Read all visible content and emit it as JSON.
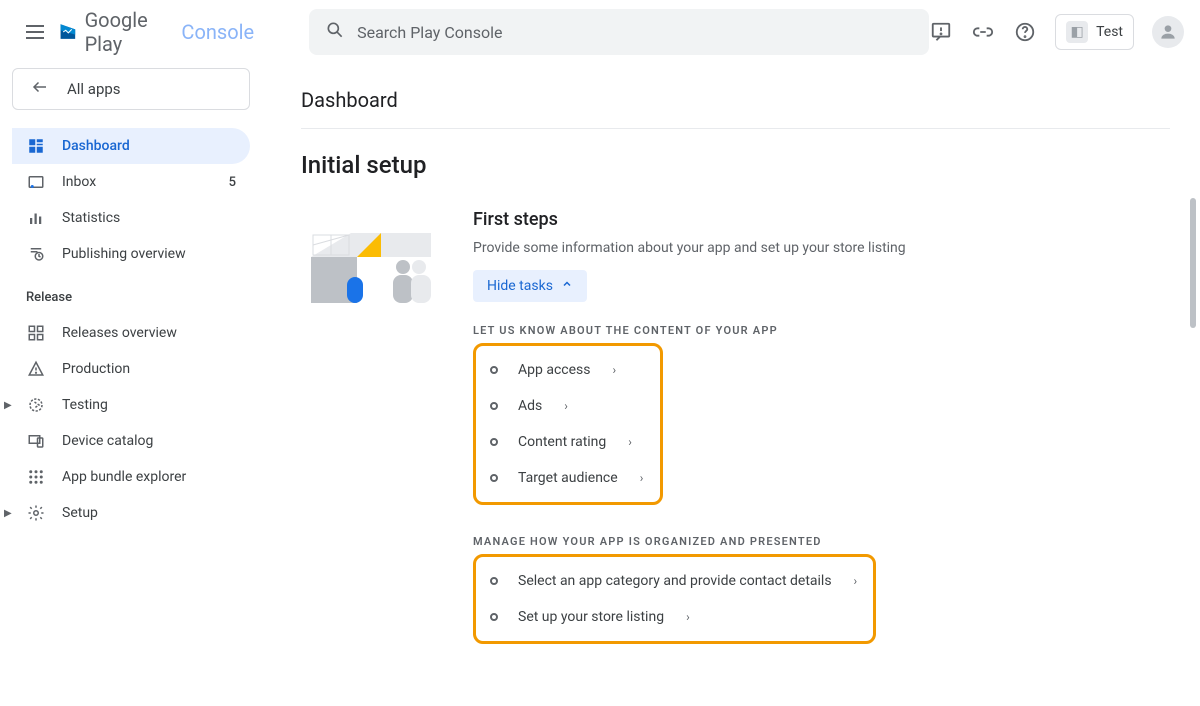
{
  "header": {
    "logo_primary": "Google Play",
    "logo_secondary": "Console",
    "search_placeholder": "Search Play Console",
    "user_app_label": "Test"
  },
  "sidebar": {
    "all_apps": "All apps",
    "nav": [
      {
        "label": "Dashboard",
        "active": true
      },
      {
        "label": "Inbox",
        "badge": "5"
      },
      {
        "label": "Statistics"
      },
      {
        "label": "Publishing overview"
      }
    ],
    "release_label": "Release",
    "release_items": [
      {
        "label": "Releases overview"
      },
      {
        "label": "Production"
      },
      {
        "label": "Testing",
        "expandable": true
      },
      {
        "label": "Device catalog"
      },
      {
        "label": "App bundle explorer"
      },
      {
        "label": "Setup",
        "expandable": true
      }
    ]
  },
  "main": {
    "page_title": "Dashboard",
    "section_title": "Initial setup",
    "first_steps": {
      "heading": "First steps",
      "description": "Provide some information about your app and set up your store listing",
      "toggle_label": "Hide tasks"
    },
    "group1": {
      "label": "LET US KNOW ABOUT THE CONTENT OF YOUR APP",
      "tasks": [
        "App access",
        "Ads",
        "Content rating",
        "Target audience"
      ]
    },
    "group2": {
      "label": "MANAGE HOW YOUR APP IS ORGANIZED AND PRESENTED",
      "tasks": [
        "Select an app category and provide contact details",
        "Set up your store listing"
      ]
    }
  }
}
